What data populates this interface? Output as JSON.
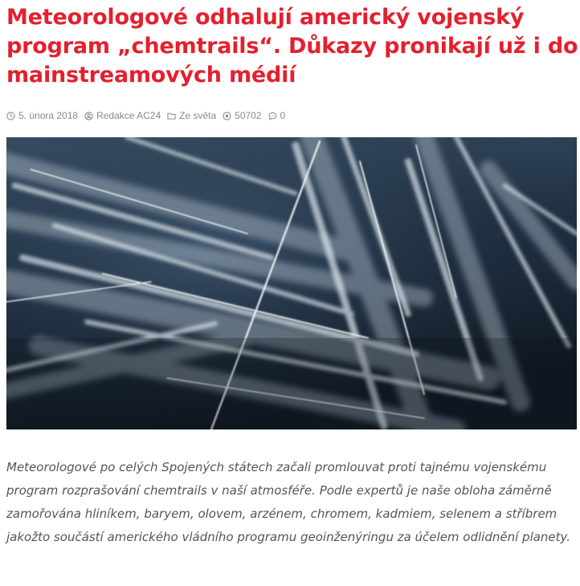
{
  "article": {
    "title": "Meteorologové odhalují americký vojenský program „chemtrails“. Důkazy pronikají už i do mainstreamových médií",
    "meta": {
      "date": "5. února 2018",
      "author": "Redakce AC24",
      "category": "Ze světa",
      "views": "50702",
      "comments": "0"
    },
    "image": {
      "subject": "sky with crisscrossing white aircraft trails"
    },
    "lede": "Meteorologové po celých Spojených státech začali promlouvat proti tajnému vojenskému program rozprašování chemtrails v naší atmosféře. Podle expertů je naše obloha záměrně zamořována hliníkem, baryem, olovem, arzénem, chromem, kadmiem, selenem a stříbrem jakožto součástí amerického vládního programu geoinženýringu za účelem odlidnění planety."
  },
  "colors": {
    "title": "#e4202e",
    "meta": "#8a8a8a",
    "body_text": "#555555",
    "sky_dark": "#121d28",
    "sky_mid": "#3a5068",
    "trail": "#e8eef2"
  },
  "icons": {
    "date": "clock-icon",
    "author": "user-icon",
    "category": "folder-icon",
    "views": "eye-icon",
    "comments": "comment-icon"
  }
}
